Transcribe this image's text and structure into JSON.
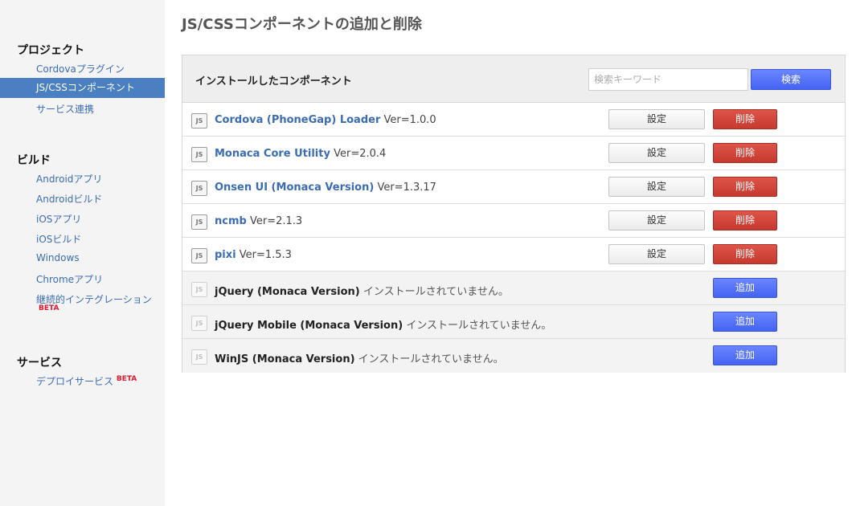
{
  "sidebar": {
    "sections": [
      {
        "heading": "プロジェクト",
        "items": [
          {
            "label": "Cordovaプラグイン"
          },
          {
            "label": "JS/CSSコンポーネント",
            "active": true
          },
          {
            "label": "サービス連携"
          }
        ]
      },
      {
        "heading": "ビルド",
        "items": [
          {
            "label": "Androidアプリ"
          },
          {
            "label": "Androidビルド"
          },
          {
            "label": "iOSアプリ"
          },
          {
            "label": "iOSビルド"
          },
          {
            "label": "Windows"
          },
          {
            "label": "Chromeアプリ"
          },
          {
            "label": "継続的インテグレーション",
            "badge": "BETA"
          }
        ]
      },
      {
        "heading": "サービス",
        "items": [
          {
            "label": "デプロイサービス",
            "badge": "BETA"
          }
        ]
      }
    ]
  },
  "main": {
    "title": "JS/CSSコンポーネントの追加と削除",
    "panel": {
      "title": "インストールしたコンポーネント",
      "search": {
        "placeholder": "検索キーワード",
        "value": "",
        "button_label": "検索"
      },
      "installed": [
        {
          "name": "Cordova (PhoneGap) Loader",
          "version": "Ver=1.0.0",
          "settings_label": "設定",
          "delete_label": "削除"
        },
        {
          "name": "Monaca Core Utility",
          "version": "Ver=2.0.4",
          "settings_label": "設定",
          "delete_label": "削除"
        },
        {
          "name": "Onsen UI (Monaca Version)",
          "version": "Ver=1.3.17",
          "settings_label": "設定",
          "delete_label": "削除"
        },
        {
          "name": "ncmb",
          "version": "Ver=2.1.3",
          "settings_label": "設定",
          "delete_label": "削除"
        },
        {
          "name": "pixi",
          "version": "Ver=1.5.3",
          "settings_label": "設定",
          "delete_label": "削除"
        }
      ],
      "available": [
        {
          "name": "jQuery (Monaca Version)",
          "status": "インストールされていません。",
          "add_label": "追加"
        },
        {
          "name": "jQuery Mobile (Monaca Version)",
          "status": "インストールされていません。",
          "add_label": "追加"
        },
        {
          "name": "WinJS (Monaca Version)",
          "status": "インストールされていません。",
          "add_label": "追加"
        }
      ],
      "icon_label": "JS"
    }
  },
  "colors": {
    "link": "#3b6cb3",
    "active_nav": "#4a7fc1",
    "delete": "#c7392e",
    "primary": "#4463f2",
    "beta": "#e0192f"
  }
}
